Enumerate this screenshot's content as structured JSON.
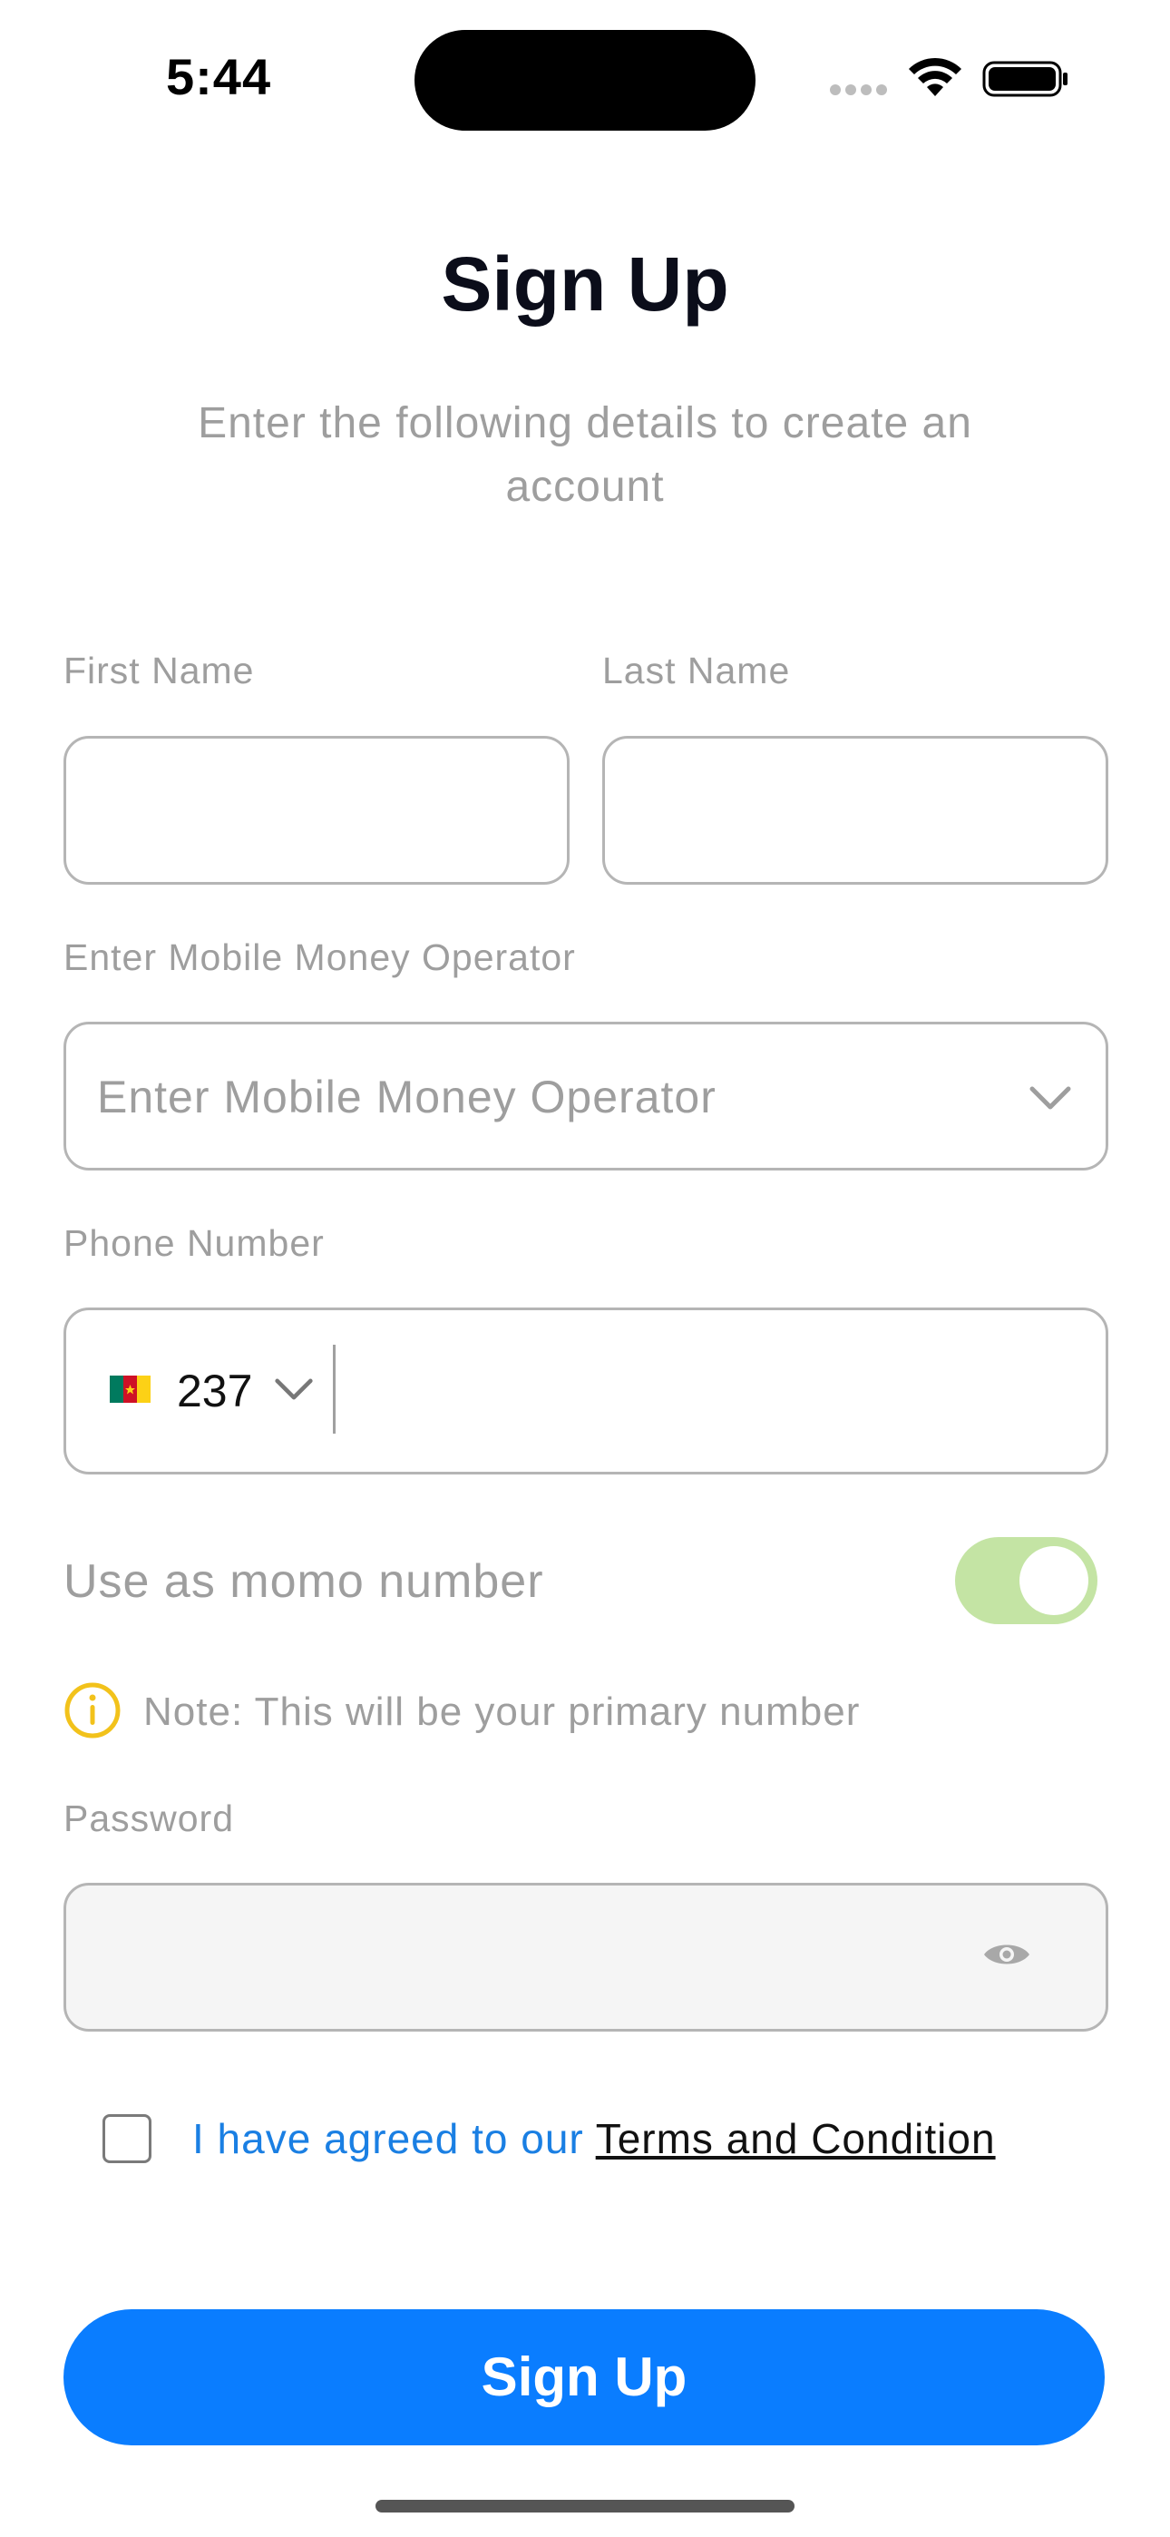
{
  "status_bar": {
    "time": "5:44"
  },
  "header": {
    "title": "Sign Up",
    "subtitle_line1": "Enter the following details to create an",
    "subtitle_line2": "account"
  },
  "form": {
    "first_name": {
      "label": "First Name",
      "value": ""
    },
    "last_name": {
      "label": "Last Name",
      "value": ""
    },
    "operator": {
      "label": "Enter Mobile Money Operator",
      "placeholder": "Enter Mobile Money Operator"
    },
    "phone": {
      "label": "Phone Number",
      "country_code": "237",
      "value": ""
    },
    "momo_toggle": {
      "label": "Use as momo number",
      "on": true
    },
    "note": "Note: This will be your primary number",
    "password": {
      "label": "Password",
      "value": ""
    },
    "terms": {
      "prefix": "I have agreed to our ",
      "link": "Terms and Condition",
      "checked": false
    }
  },
  "actions": {
    "signup_label": "Sign Up"
  },
  "colors": {
    "primary": "#0a7dff",
    "toggle_on": "#c4e4a4",
    "info": "#f2c21b",
    "link_text": "#1a7fe3"
  },
  "icons": {
    "operator_dropdown": "chevron-down-icon",
    "country_dropdown": "chevron-down-icon",
    "note": "info-icon",
    "password_visibility": "eye-icon",
    "country_flag": "cameroon-flag-icon"
  }
}
